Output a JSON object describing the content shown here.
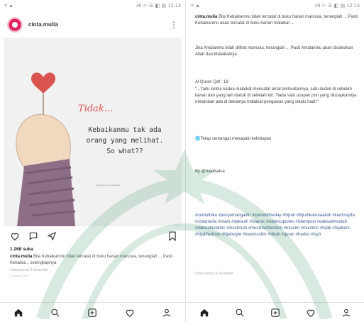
{
  "left": {
    "status_time": "HI ✁ ☰ ◧ ▤ 12:13",
    "post_username": "cinta.mulia",
    "image_text_title": "Tidak...",
    "image_text_line1": "Kebaikanmu tak ada",
    "image_text_line2": "orang yang melihat.",
    "image_text_line3": "So what??",
    "image_credit": "@cinta.mulia | cintamulia",
    "likes": "1.268 suka",
    "caption_user": "cinta.mulia",
    "caption_text": "Bila Kebaikanmu tidak tercatat di buku harian manusia, tenanglah ... Pasti Kebaika... selengkapnya",
    "comments": "Lihat semua 4 komentar",
    "date": "6 Januari 2019"
  },
  "right": {
    "status_time": "HI ✁ ☰ ◧ ▤ 12:13",
    "caption_user": "cinta.mulia",
    "caption_p1": "Bila Kebaikanmu tidak tercatat di buku harian manusia, tenanglah ... Pasti Kebaikanmu akan tercatat di buku harian malaikat ...",
    "caption_p2": "Jika Amalanmu tidak dilihat manusia, tenanglah ... Pasti Amalanmu akan disaksikan Allah dan Malaikatnya.",
    "caption_p3_title": "Al Quran Qaf : 18",
    "caption_p3": "\"...Yaitu ketika kedua malaikat mencatat amal perbuatannya, satu duduk di sebelah kanan dan yang lain duduk di sebelah kiri. Tiada satu ucapan pun yang diucapkannya melainkan ada di dekatnya malaikat pengawas yang selalu hadir\"",
    "caption_p4": "🌐Tetap semangat menapaki kehidupan",
    "by_line": "By @madisalsa",
    "hashtags": "#cerbotbiku #pesyemangadiri #quoteoftheday #hijrah #hijrahkarenaallah #kamissyifa #cintamulia #islam #dakwah #islamic #islamicquotes #islampost #dakwahmudah #dakwahislamic #muslimah #muslimahfashion #muslim #muslims #hijab #hijabers #hijabfashion #hijabstyle #lovemuslim #nikah #quran #hadist #tsyb",
    "comments": "Lihat semua 4 komentar"
  },
  "icons": {
    "home": "home-icon",
    "search": "search-icon",
    "add": "add-post-icon",
    "activity": "heart-icon",
    "profile": "profile-icon"
  },
  "colors": {
    "accent": "#e0245e",
    "hashtag": "#3b5d8f",
    "watermark": "#2e8b57"
  }
}
